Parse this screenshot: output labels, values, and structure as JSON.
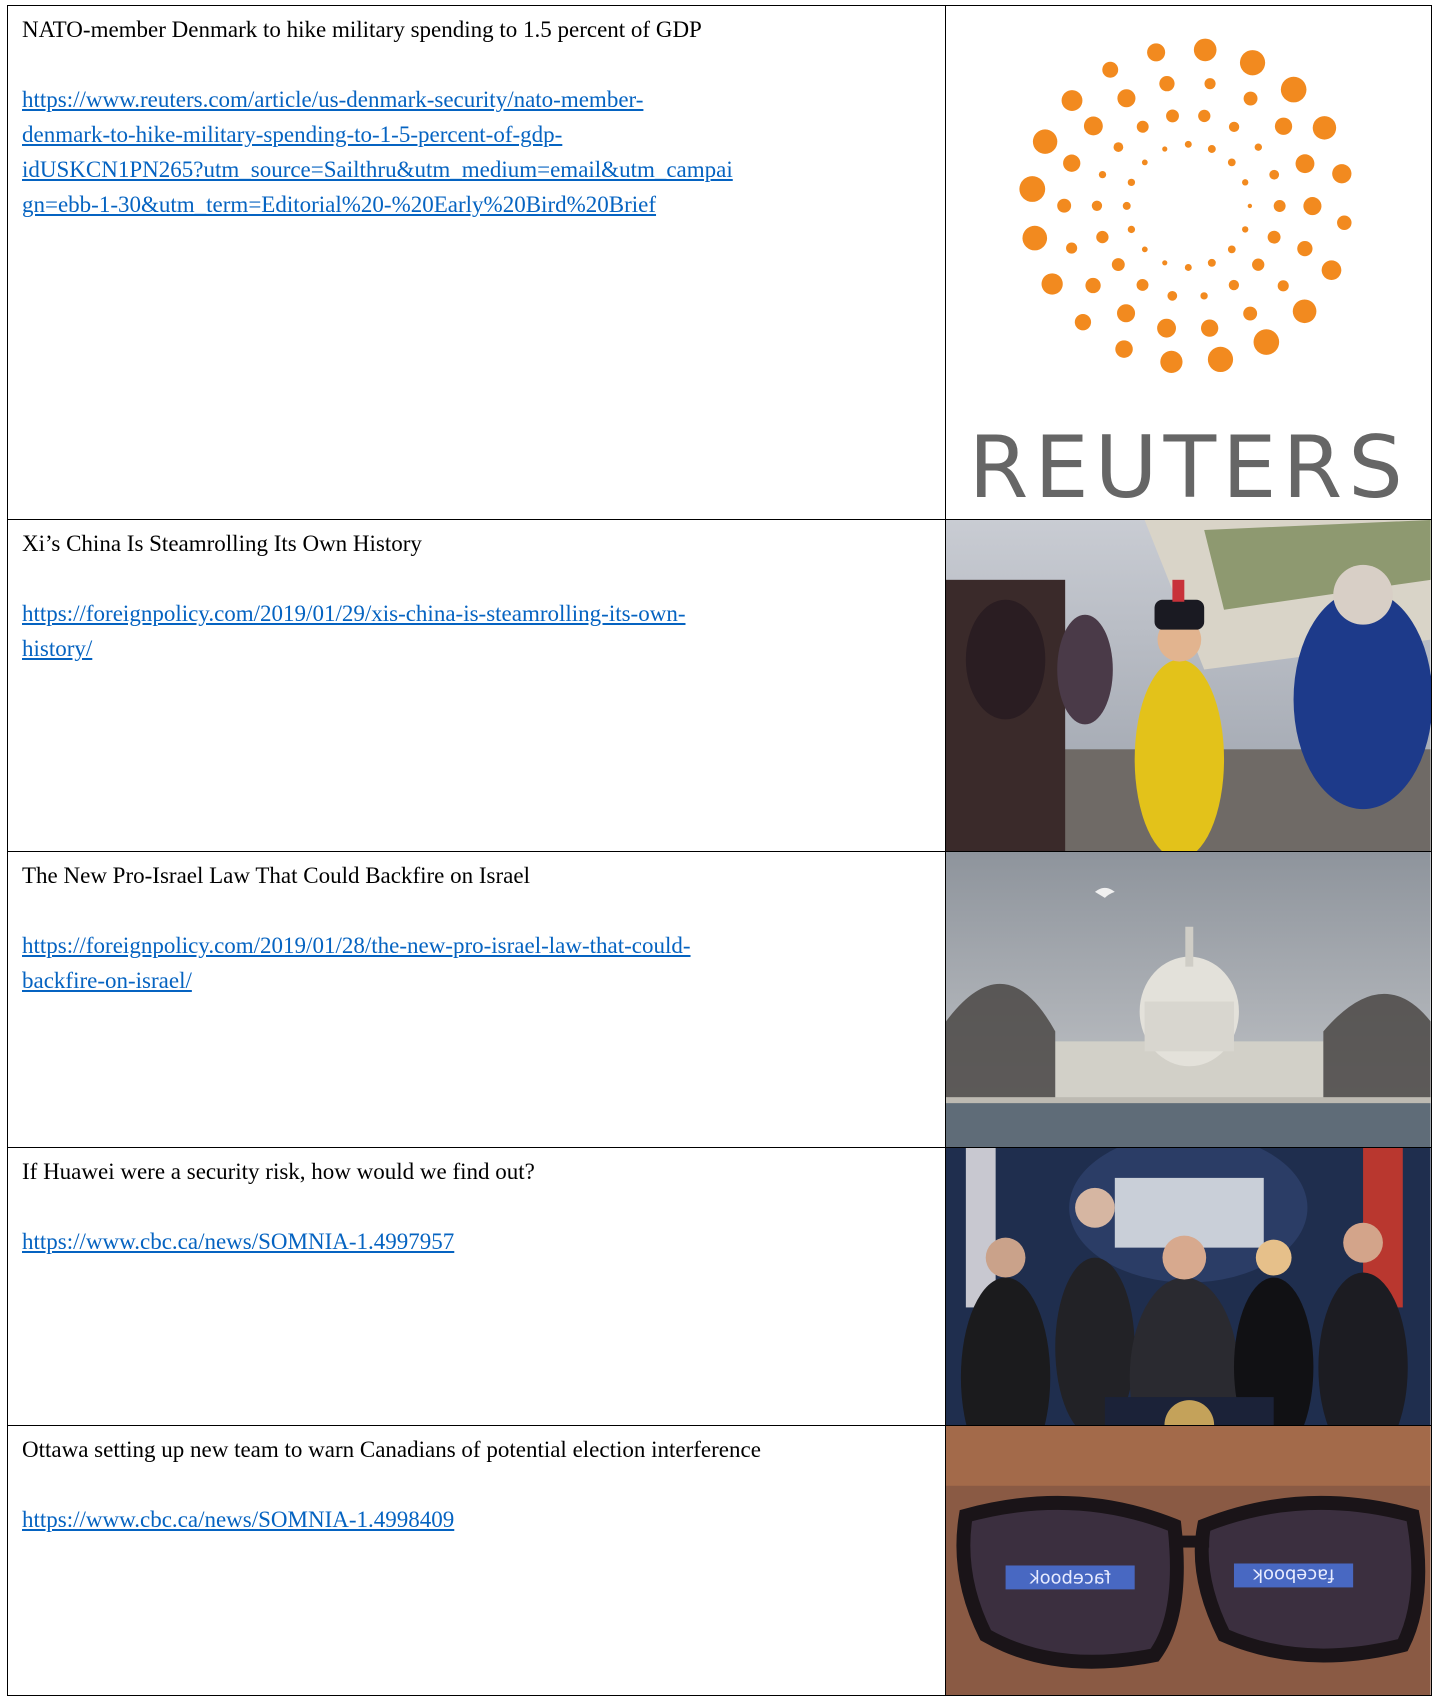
{
  "rows": [
    {
      "title": "NATO-member Denmark to hike military spending to 1.5 percent of GDP",
      "url": "https://www.reuters.com/article/us-denmark-security/nato-member-denmark-to-hike-military-spending-to-1-5-percent-of-gdp-idUSKCN1PN265?utm_source=Sailthru&utm_medium=email&utm_campaign=ebb-1-30&utm_term=Editorial%20-%20Early%20Bird%20Brief",
      "url_lines": [
        "https://www.reuters.com/article/us-denmark-security/nato-member-",
        "denmark-to-hike-military-spending-to-1-5-percent-of-gdp-",
        "idUSKCN1PN265?utm_source=Sailthru&utm_medium=email&utm_campai",
        "gn=ebb-1-30&utm_term=Editorial%20-%20Early%20Bird%20Brief"
      ],
      "image": "reuters-logo",
      "logo_text": "REUTERS"
    },
    {
      "title": "Xi’s China Is Steamrolling Its Own History",
      "url_lines": [
        "https://foreignpolicy.com/2019/01/29/xis-china-is-steamrolling-its-own-",
        "history/"
      ],
      "image": "child-in-qing-costume-photo"
    },
    {
      "title": "The New Pro-Israel Law That Could Backfire on Israel",
      "url_lines": [
        "https://foreignpolicy.com/2019/01/28/the-new-pro-israel-law-that-could-",
        "backfire-on-israel/"
      ],
      "image": "us-capitol-photo"
    },
    {
      "title": "If Huawei were a security risk, how would we find out?",
      "url_lines": [
        "https://www.cbc.ca/news/SOMNIA-1.4997957"
      ],
      "image": "press-conference-photo"
    },
    {
      "title": "Ottawa setting up new team to warn Canadians of potential election interference",
      "url_lines": [
        "https://www.cbc.ca/news/SOMNIA-1.4998409"
      ],
      "image": "glasses-facebook-reflection-photo",
      "reflection_text": "facebook"
    }
  ],
  "colors": {
    "link": "#0563c1",
    "reuters_orange": "#f28a1f",
    "logo_grey": "#666666"
  }
}
